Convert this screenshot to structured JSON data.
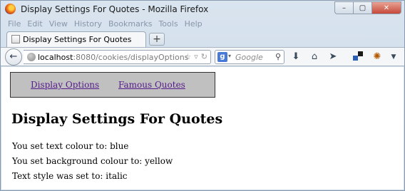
{
  "window": {
    "title": "Display Settings For Quotes - Mozilla Firefox",
    "minimize": "–",
    "maximize": "▢",
    "close": "✕"
  },
  "menu": [
    {
      "label": "File"
    },
    {
      "label": "Edit"
    },
    {
      "label": "View"
    },
    {
      "label": "History"
    },
    {
      "label": "Bookmarks"
    },
    {
      "label": "Tools"
    },
    {
      "label": "Help"
    }
  ],
  "tab": {
    "label": "Display Settings For Quotes",
    "close": "×",
    "new_tab": "+"
  },
  "navbar": {
    "url_host": "localhost",
    "url_rest": ":8080/cookies/displayOptions",
    "search_placeholder": "Google",
    "search_engine_letter": "g"
  },
  "page": {
    "links": [
      {
        "label": "Display Options"
      },
      {
        "label": "Famous Quotes"
      }
    ],
    "heading": "Display Settings For Quotes",
    "lines": [
      "You set text colour to: blue",
      "You set background colour to: yellow",
      "Text style was set to: italic"
    ]
  }
}
